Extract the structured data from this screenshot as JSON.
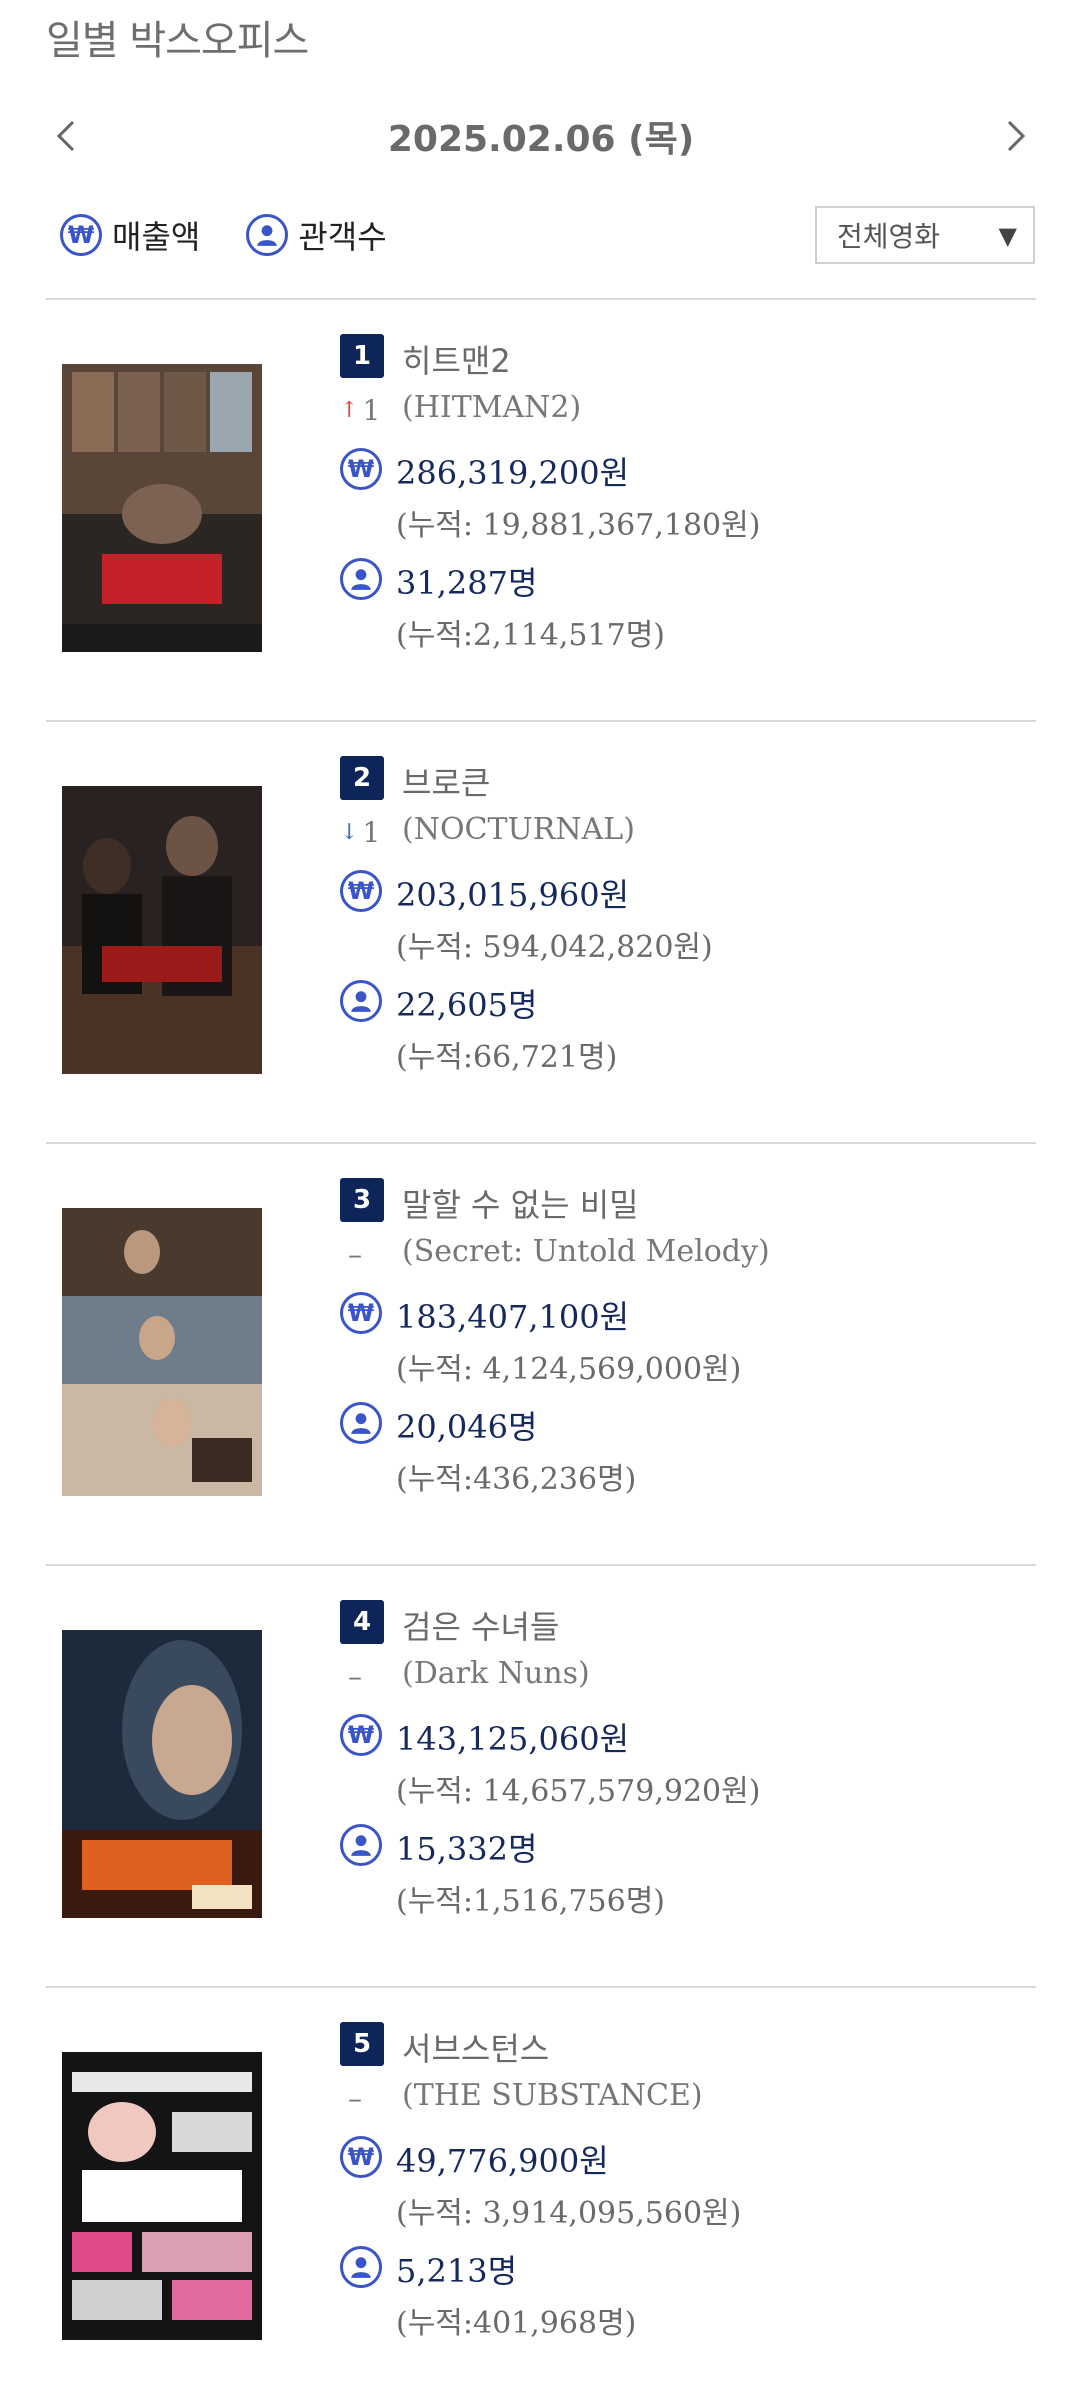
{
  "page": {
    "title": "일별 박스오피스",
    "date": "2025.02.06 (목)"
  },
  "legend": {
    "sales_label": "매출액",
    "audience_label": "관객수"
  },
  "filter": {
    "selected": "전체영화"
  },
  "colors": {
    "accent": "#3a55c7",
    "rank_bg": "#0d2559",
    "up": "#e0453a",
    "down": "#3a6fc7"
  },
  "icons": {
    "prev": "chevron-left-icon",
    "next": "chevron-right-icon",
    "sales": "won-icon",
    "audience": "person-icon"
  },
  "movies": [
    {
      "rank": "1",
      "title": "히트맨2",
      "change_dir": "up",
      "change": "1",
      "en_title": "(HITMAN2)",
      "sales": "286,319,200원",
      "sales_cum": "(누적: 19,881,367,180원)",
      "audience": "31,287명",
      "audience_cum": "(누적:2,114,517명)"
    },
    {
      "rank": "2",
      "title": "브로큰",
      "change_dir": "down",
      "change": "1",
      "en_title": "(NOCTURNAL)",
      "sales": "203,015,960원",
      "sales_cum": "(누적: 594,042,820원)",
      "audience": "22,605명",
      "audience_cum": "(누적:66,721명)"
    },
    {
      "rank": "3",
      "title": "말할 수 없는 비밀",
      "change_dir": "none",
      "change": "–",
      "en_title": "(Secret: Untold Melody)",
      "sales": "183,407,100원",
      "sales_cum": "(누적: 4,124,569,000원)",
      "audience": "20,046명",
      "audience_cum": "(누적:436,236명)"
    },
    {
      "rank": "4",
      "title": "검은 수녀들",
      "change_dir": "none",
      "change": "–",
      "en_title": "(Dark Nuns)",
      "sales": "143,125,060원",
      "sales_cum": "(누적: 14,657,579,920원)",
      "audience": "15,332명",
      "audience_cum": "(누적:1,516,756명)"
    },
    {
      "rank": "5",
      "title": "서브스턴스",
      "change_dir": "none",
      "change": "–",
      "en_title": "(THE SUBSTANCE)",
      "sales": "49,776,900원",
      "sales_cum": "(누적: 3,914,095,560원)",
      "audience": "5,213명",
      "audience_cum": "(누적:401,968명)"
    }
  ]
}
